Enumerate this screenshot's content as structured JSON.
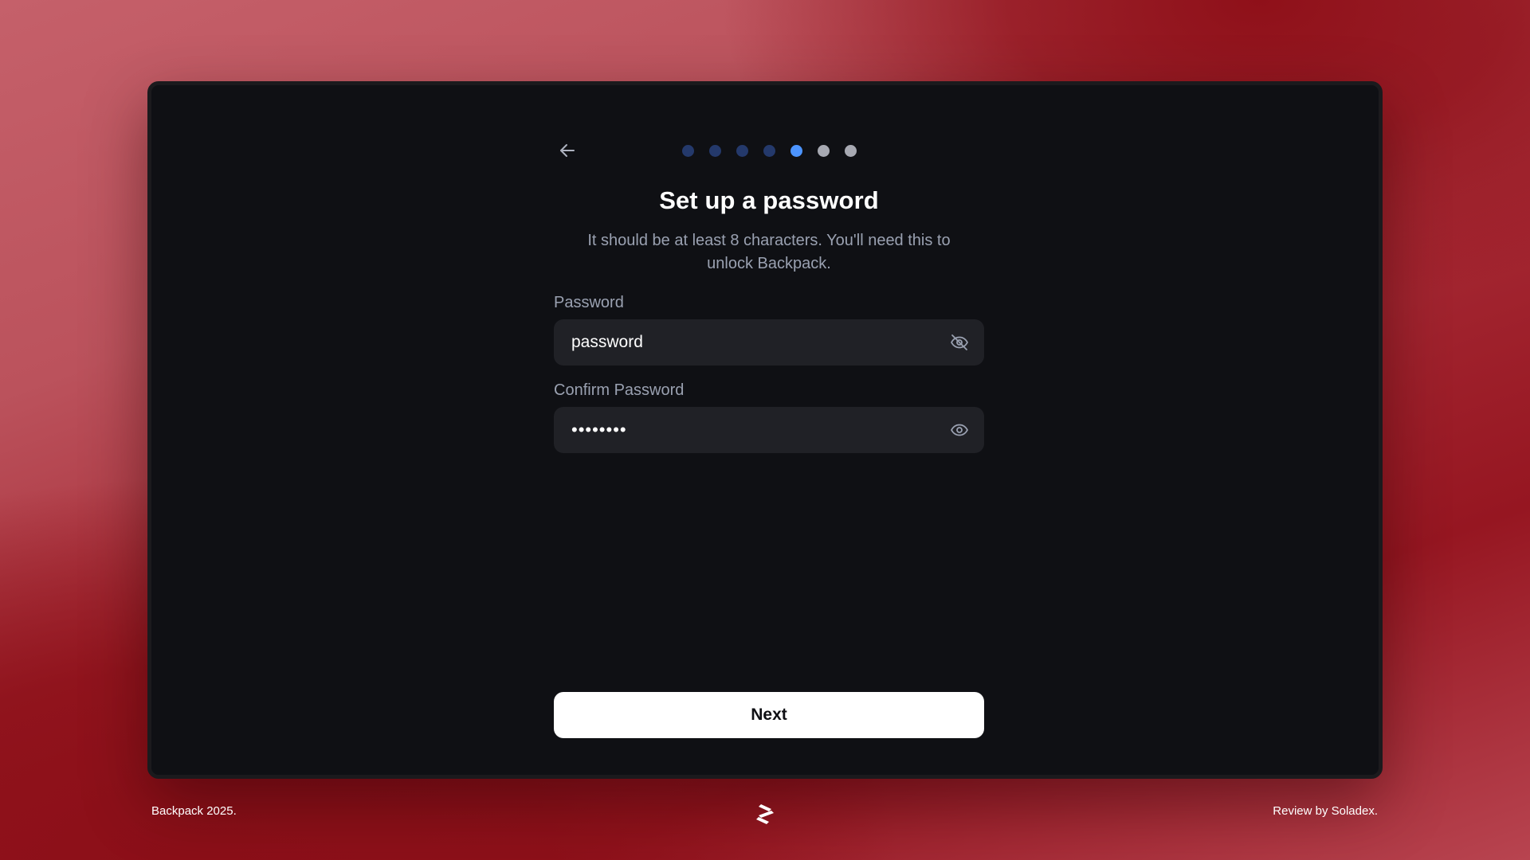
{
  "onboarding": {
    "steps_total": 7,
    "current_step": 5,
    "step_colors": {
      "completed": "#24396b",
      "active": "#4c94ff",
      "upcoming": "#a7a9b2"
    },
    "title": "Set up a password",
    "subtitle": "It should be at least 8 characters. You'll need this to unlock Backpack.",
    "password": {
      "label": "Password",
      "value": "password",
      "visibility_icon": "eye-off-icon"
    },
    "confirm_password": {
      "label": "Confirm Password",
      "value": "••••••••",
      "visibility_icon": "eye-icon"
    },
    "next_label": "Next"
  },
  "footer": {
    "left_text": "Backpack 2025.",
    "logo_icon": "soladex-logo-icon",
    "right_text": "Review by Soladex."
  }
}
